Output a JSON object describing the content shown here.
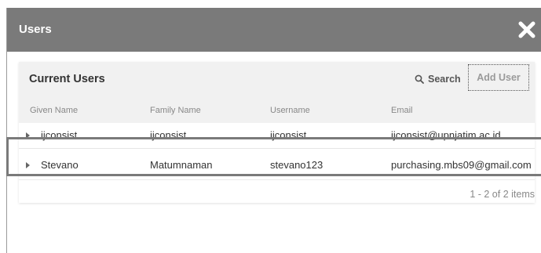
{
  "dialog": {
    "title": "Users",
    "close_icon": "close-icon"
  },
  "panel": {
    "title": "Current Users",
    "search_label": "Search",
    "search_icon": "search-icon",
    "add_user_label": "Add User"
  },
  "table": {
    "columns": [
      "Given Name",
      "Family Name",
      "Username",
      "Email"
    ],
    "rows": [
      {
        "given": "ijconsist",
        "family": "ijconsist",
        "username": "ijconsist",
        "email": "ijconsist@upnjatim.ac.id"
      },
      {
        "given": "Stevano",
        "family": "Matumnaman",
        "username": "stevano123",
        "email": "purchasing.mbs09@gmail.com"
      }
    ]
  },
  "pager": {
    "info": "1 - 2 of 2 items"
  },
  "colors": {
    "header_bg": "#7a7a7a",
    "panel_header_bg": "#f1f1f1",
    "highlight_border": "#7a7a7a"
  }
}
